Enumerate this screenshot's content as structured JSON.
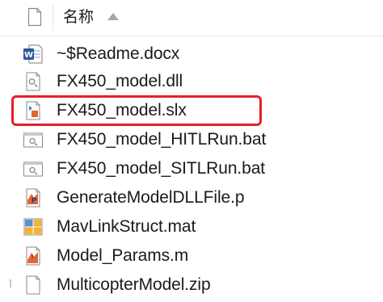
{
  "header": {
    "name_column_label": "名称"
  },
  "files": [
    {
      "name": "~$Readme.docx",
      "icon": "word-document-icon"
    },
    {
      "name": "FX450_model.dll",
      "icon": "dll-file-icon"
    },
    {
      "name": "FX450_model.slx",
      "icon": "simulink-model-icon"
    },
    {
      "name": "FX450_model_HITLRun.bat",
      "icon": "batch-file-icon"
    },
    {
      "name": "FX450_model_SITLRun.bat",
      "icon": "batch-file-icon"
    },
    {
      "name": "GenerateModelDLLFile.p",
      "icon": "matlab-p-file-icon"
    },
    {
      "name": "MavLinkStruct.mat",
      "icon": "mat-file-icon"
    },
    {
      "name": "Model_Params.m",
      "icon": "matlab-script-icon"
    },
    {
      "name": "MulticopterModel.zip",
      "icon": "blank-file-icon"
    }
  ],
  "colors": {
    "highlight": "#e5202a",
    "word_blue": "#2b579a",
    "matlab_orange": "#e16737"
  }
}
